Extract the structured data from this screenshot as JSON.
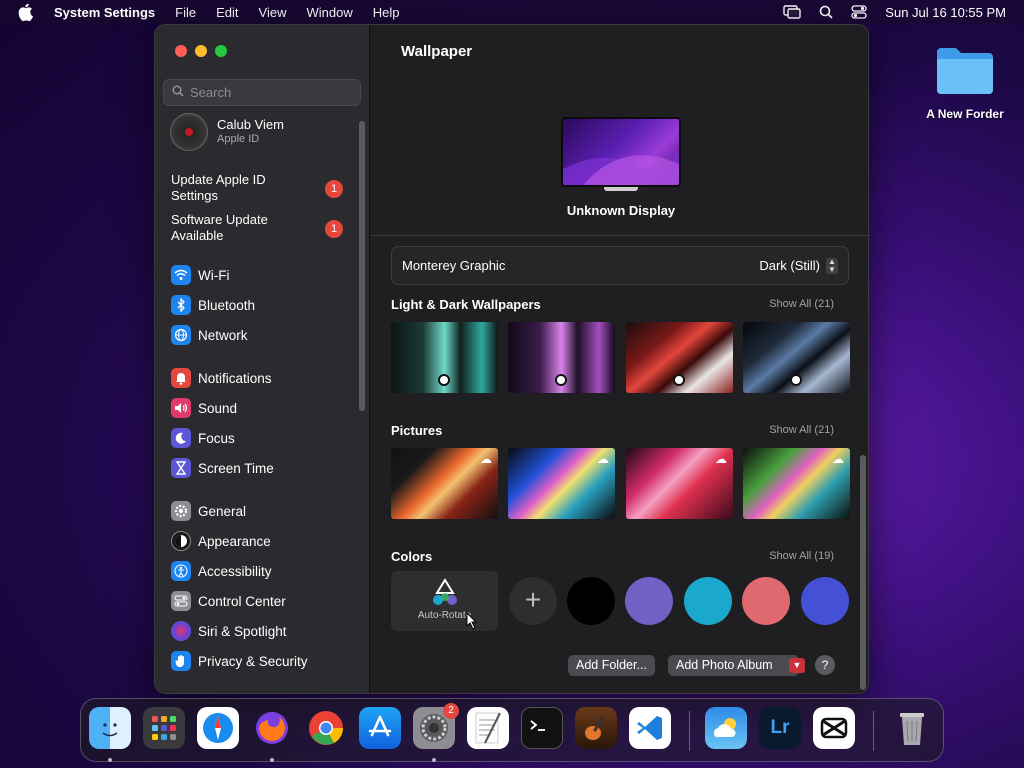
{
  "menubar": {
    "app_name": "System Settings",
    "menus": [
      "File",
      "Edit",
      "View",
      "Window",
      "Help"
    ],
    "datetime": "Sun Jul 16  10:55 PM"
  },
  "desktop": {
    "folder_label": "A New Forder"
  },
  "sidebar": {
    "search_placeholder": "Search",
    "account": {
      "name": "Calub Viem",
      "subtitle": "Apple ID"
    },
    "alerts": [
      {
        "label": "Update Apple ID Settings",
        "badge": "1"
      },
      {
        "label": "Software Update Available",
        "badge": "1"
      }
    ],
    "items": [
      {
        "label": "Wi-Fi",
        "icon": "wifi-icon",
        "color": "#1e84f0"
      },
      {
        "label": "Bluetooth",
        "icon": "bluetooth-icon",
        "color": "#1e84f0"
      },
      {
        "label": "Network",
        "icon": "globe-icon",
        "color": "#1e84f0"
      },
      {
        "label": "Notifications",
        "icon": "bell-icon",
        "color": "#e4473d"
      },
      {
        "label": "Sound",
        "icon": "speaker-icon",
        "color": "#e0396c"
      },
      {
        "label": "Focus",
        "icon": "moon-icon",
        "color": "#5b57d6"
      },
      {
        "label": "Screen Time",
        "icon": "hourglass-icon",
        "color": "#5b57d6"
      },
      {
        "label": "General",
        "icon": "gear-icon",
        "color": "#8e8d92"
      },
      {
        "label": "Appearance",
        "icon": "appearance-icon",
        "color": "#1a1a1a"
      },
      {
        "label": "Accessibility",
        "icon": "accessibility-icon",
        "color": "#1e84f0"
      },
      {
        "label": "Control Center",
        "icon": "control-center-icon",
        "color": "#8e8d92"
      },
      {
        "label": "Siri & Spotlight",
        "icon": "siri-icon",
        "color": "#6b3fd4"
      },
      {
        "label": "Privacy & Security",
        "icon": "hand-icon",
        "color": "#1e84f0"
      }
    ]
  },
  "main": {
    "title": "Wallpaper",
    "display_name": "Unknown Display",
    "wallpaper_name": "Monterey Graphic",
    "wallpaper_mode": "Dark (Still)",
    "sections": {
      "light_dark": {
        "title": "Light & Dark Wallpapers",
        "show_all": "Show All (21)"
      },
      "pictures": {
        "title": "Pictures",
        "show_all": "Show All (21)"
      },
      "colors": {
        "title": "Colors",
        "show_all": "Show All (19)"
      }
    },
    "auto_rotate_label": "Auto-Rotate",
    "colors": [
      "#000000",
      "#6f62c4",
      "#1aa9cc",
      "#e0696f",
      "#4450d6"
    ],
    "add_folder_label": "Add Folder...",
    "add_photo_album_label": "Add Photo Album",
    "help_label": "?"
  },
  "dock": {
    "apps": [
      {
        "name": "finder",
        "label": "Finder"
      },
      {
        "name": "launchpad",
        "label": "Launchpad"
      },
      {
        "name": "safari",
        "label": "Safari"
      },
      {
        "name": "firefox",
        "label": "Firefox"
      },
      {
        "name": "chrome",
        "label": "Chrome"
      },
      {
        "name": "app-store",
        "label": "App Store"
      },
      {
        "name": "system-settings",
        "label": "System Settings",
        "badge": "2"
      },
      {
        "name": "textedit",
        "label": "TextEdit"
      },
      {
        "name": "terminal",
        "label": "Terminal"
      },
      {
        "name": "garageband",
        "label": "GarageBand"
      },
      {
        "name": "vscode",
        "label": "VS Code"
      },
      {
        "name": "weather",
        "label": "Weather"
      },
      {
        "name": "lightroom",
        "label": "Lr"
      },
      {
        "name": "capcut",
        "label": "CapCut"
      },
      {
        "name": "trash",
        "label": "Trash"
      }
    ]
  }
}
